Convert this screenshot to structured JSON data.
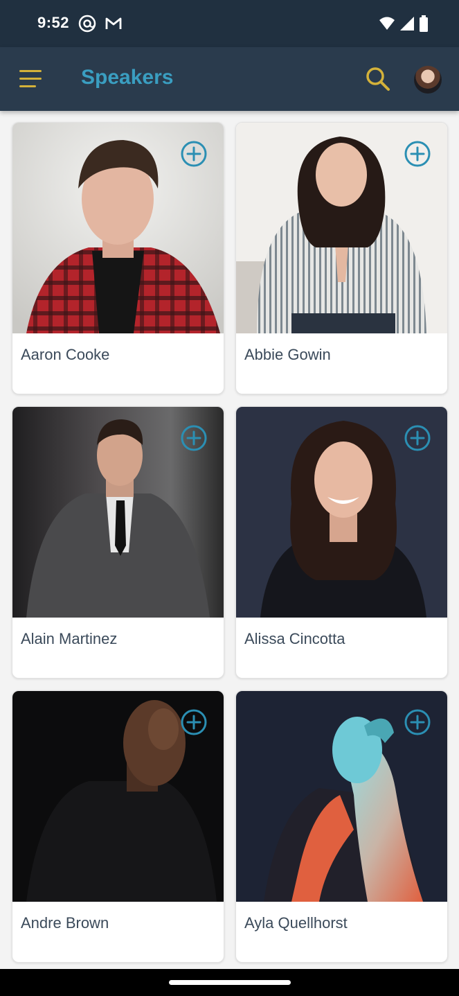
{
  "status_bar": {
    "time": "9:52",
    "icons_left": [
      "at-sign-icon",
      "gmail-icon"
    ],
    "icons_right": [
      "wifi-icon",
      "signal-icon",
      "battery-icon"
    ]
  },
  "app_bar": {
    "title": "Speakers",
    "menu_icon": "hamburger-menu-icon",
    "search_icon": "search-icon",
    "accent_color": "#3a9ec1",
    "icon_color": "#d4b23a"
  },
  "speakers": [
    {
      "name": "Aaron Cooke"
    },
    {
      "name": "Abbie Gowin"
    },
    {
      "name": "Alain Martinez"
    },
    {
      "name": "Alissa Cincotta"
    },
    {
      "name": "Andre Brown"
    },
    {
      "name": "Ayla Quellhorst"
    }
  ],
  "add_icon": "plus-circle-icon"
}
